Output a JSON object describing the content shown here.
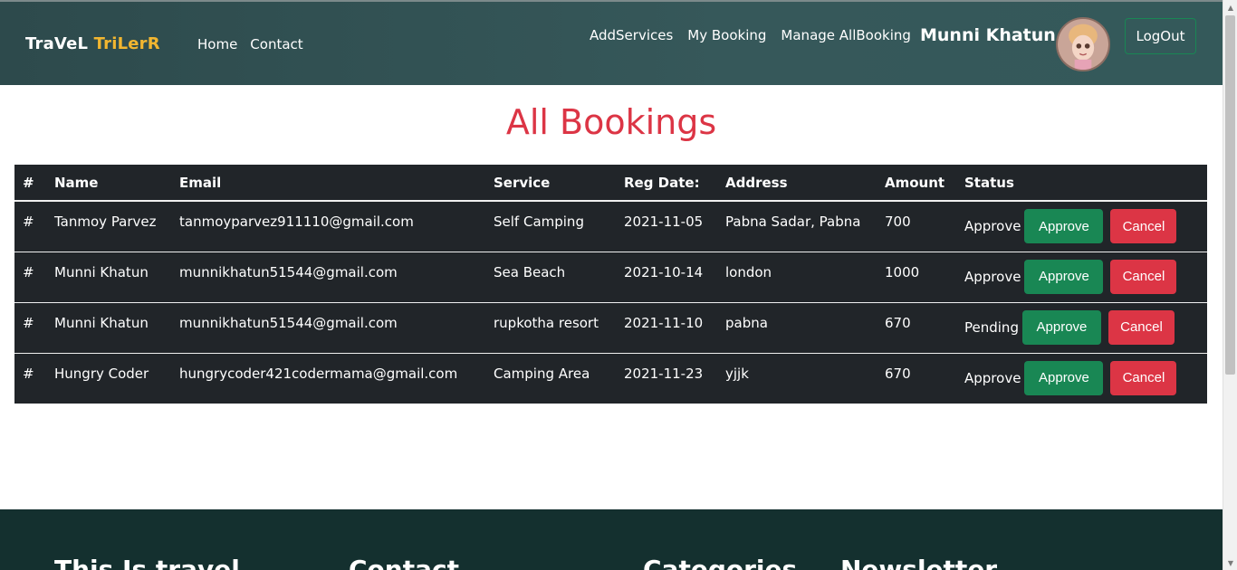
{
  "header": {
    "brand_part1": "TraVeL",
    "brand_part2": "TriLerR",
    "nav_left": [
      "Home",
      "Contact"
    ],
    "nav_right": [
      "AddServices",
      "My Booking",
      "Manage AllBooking"
    ],
    "user_name": "Munni Khatun",
    "logout_label": "LogOut",
    "brand_accent_color": "#f2b630"
  },
  "main": {
    "title": "All Bookings",
    "table": {
      "columns": [
        "#",
        "Name",
        "Email",
        "Service",
        "Reg Date:",
        "Address",
        "Amount",
        "Status"
      ],
      "rows": [
        {
          "hash": "#",
          "name": "Tanmoy Parvez",
          "email": "tanmoyparvez911110@gmail.com",
          "service": "Self Camping",
          "date": "2021-11-05",
          "address": "Pabna Sadar, Pabna",
          "amount": "700",
          "status": "Approve",
          "approve_label": "Approve",
          "cancel_label": "Cancel"
        },
        {
          "hash": "#",
          "name": "Munni Khatun",
          "email": "munnikhatun51544@gmail.com",
          "service": "Sea Beach",
          "date": "2021-10-14",
          "address": "london",
          "amount": "1000",
          "status": "Approve",
          "approve_label": "Approve",
          "cancel_label": "Cancel"
        },
        {
          "hash": "#",
          "name": "Munni Khatun",
          "email": "munnikhatun51544@gmail.com",
          "service": "rupkotha resort",
          "date": "2021-11-10",
          "address": "pabna",
          "amount": "670",
          "status": "Pending",
          "approve_label": "Approve",
          "cancel_label": "Cancel"
        },
        {
          "hash": "#",
          "name": "Hungry Coder",
          "email": "hungrycoder421codermama@gmail.com",
          "service": "Camping Area",
          "date": "2021-11-23",
          "address": "yjjk",
          "amount": "670",
          "status": "Approve",
          "approve_label": "Approve",
          "cancel_label": "Cancel"
        }
      ]
    }
  },
  "footer": {
    "headings": [
      "This Is travel",
      "Contact",
      "Categories",
      "Newsletter"
    ]
  },
  "colors": {
    "navbar": "#2d4a4c",
    "title": "#dc3545",
    "table_bg": "#212529",
    "approve": "#198754",
    "cancel": "#dc3545",
    "footer": "#14302f"
  }
}
